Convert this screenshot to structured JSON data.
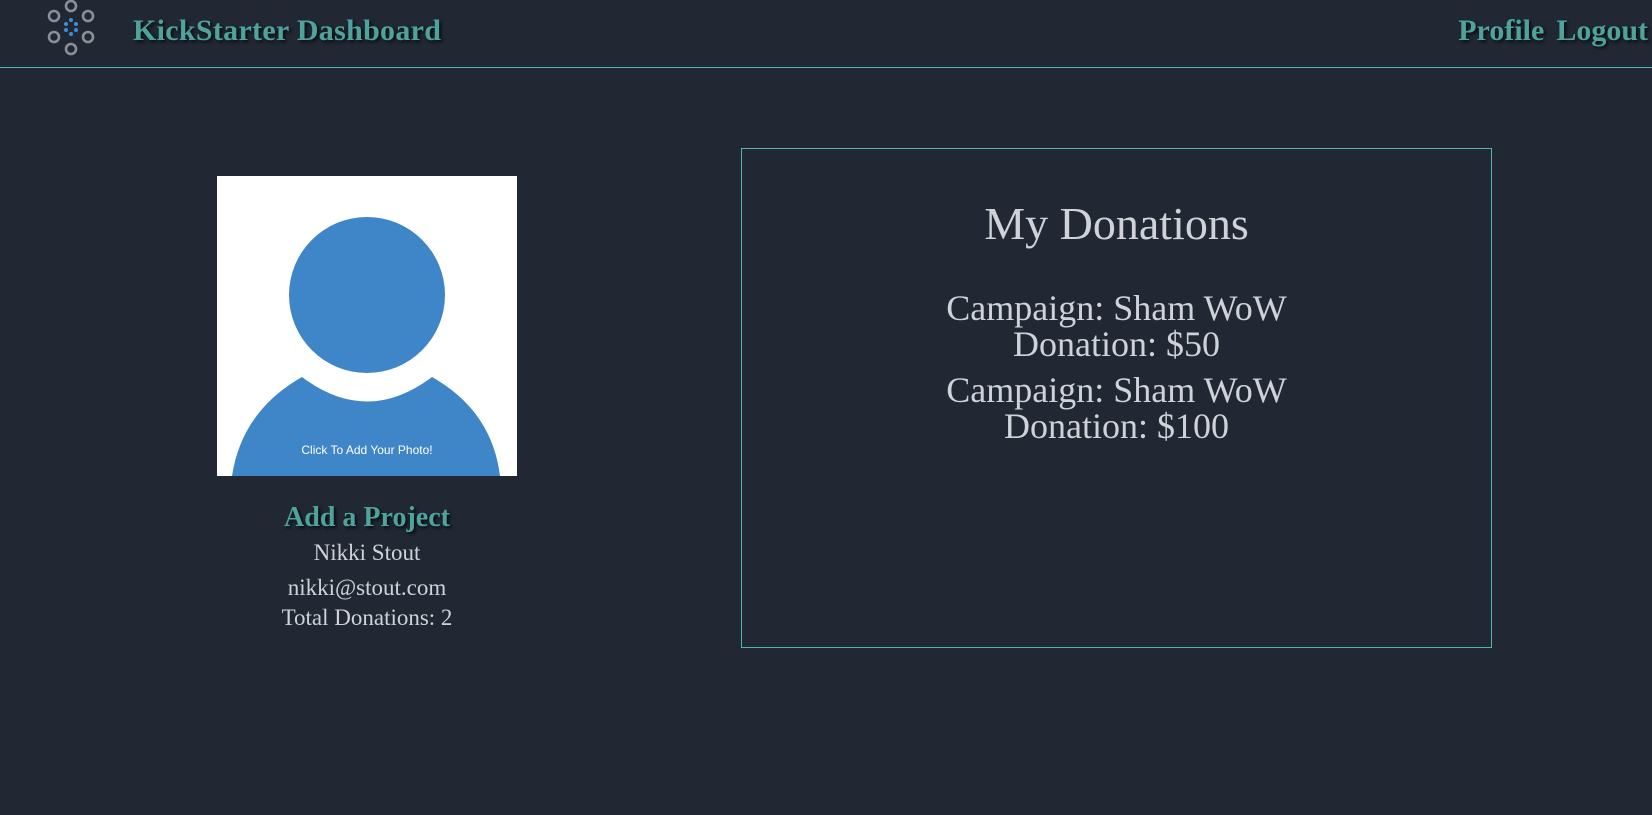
{
  "header": {
    "brand": "KickStarter Dashboard",
    "logo_icon": "loading-spinner-icon",
    "nav": [
      {
        "label": "Profile"
      },
      {
        "label": "Logout"
      }
    ],
    "accent_color": "#4ea39c",
    "border_color": "#4fb6b1"
  },
  "profile": {
    "photo_caption": "Click To Add Your Photo!",
    "avatar_icon": "user-silhouette-icon",
    "avatar_color": "#3f86c8",
    "add_project_label": "Add a Project",
    "name": "Nikki Stout",
    "email": "nikki@stout.com",
    "total_donations": "Total Donations: 2"
  },
  "donations": {
    "title": "My Donations",
    "items": [
      {
        "campaign": "Campaign: Sham WoW",
        "amount": "Donation: $50"
      },
      {
        "campaign": "Campaign: Sham WoW",
        "amount": "Donation: $100"
      }
    ]
  },
  "colors": {
    "background": "#212834",
    "text": "#cfd2d8"
  }
}
